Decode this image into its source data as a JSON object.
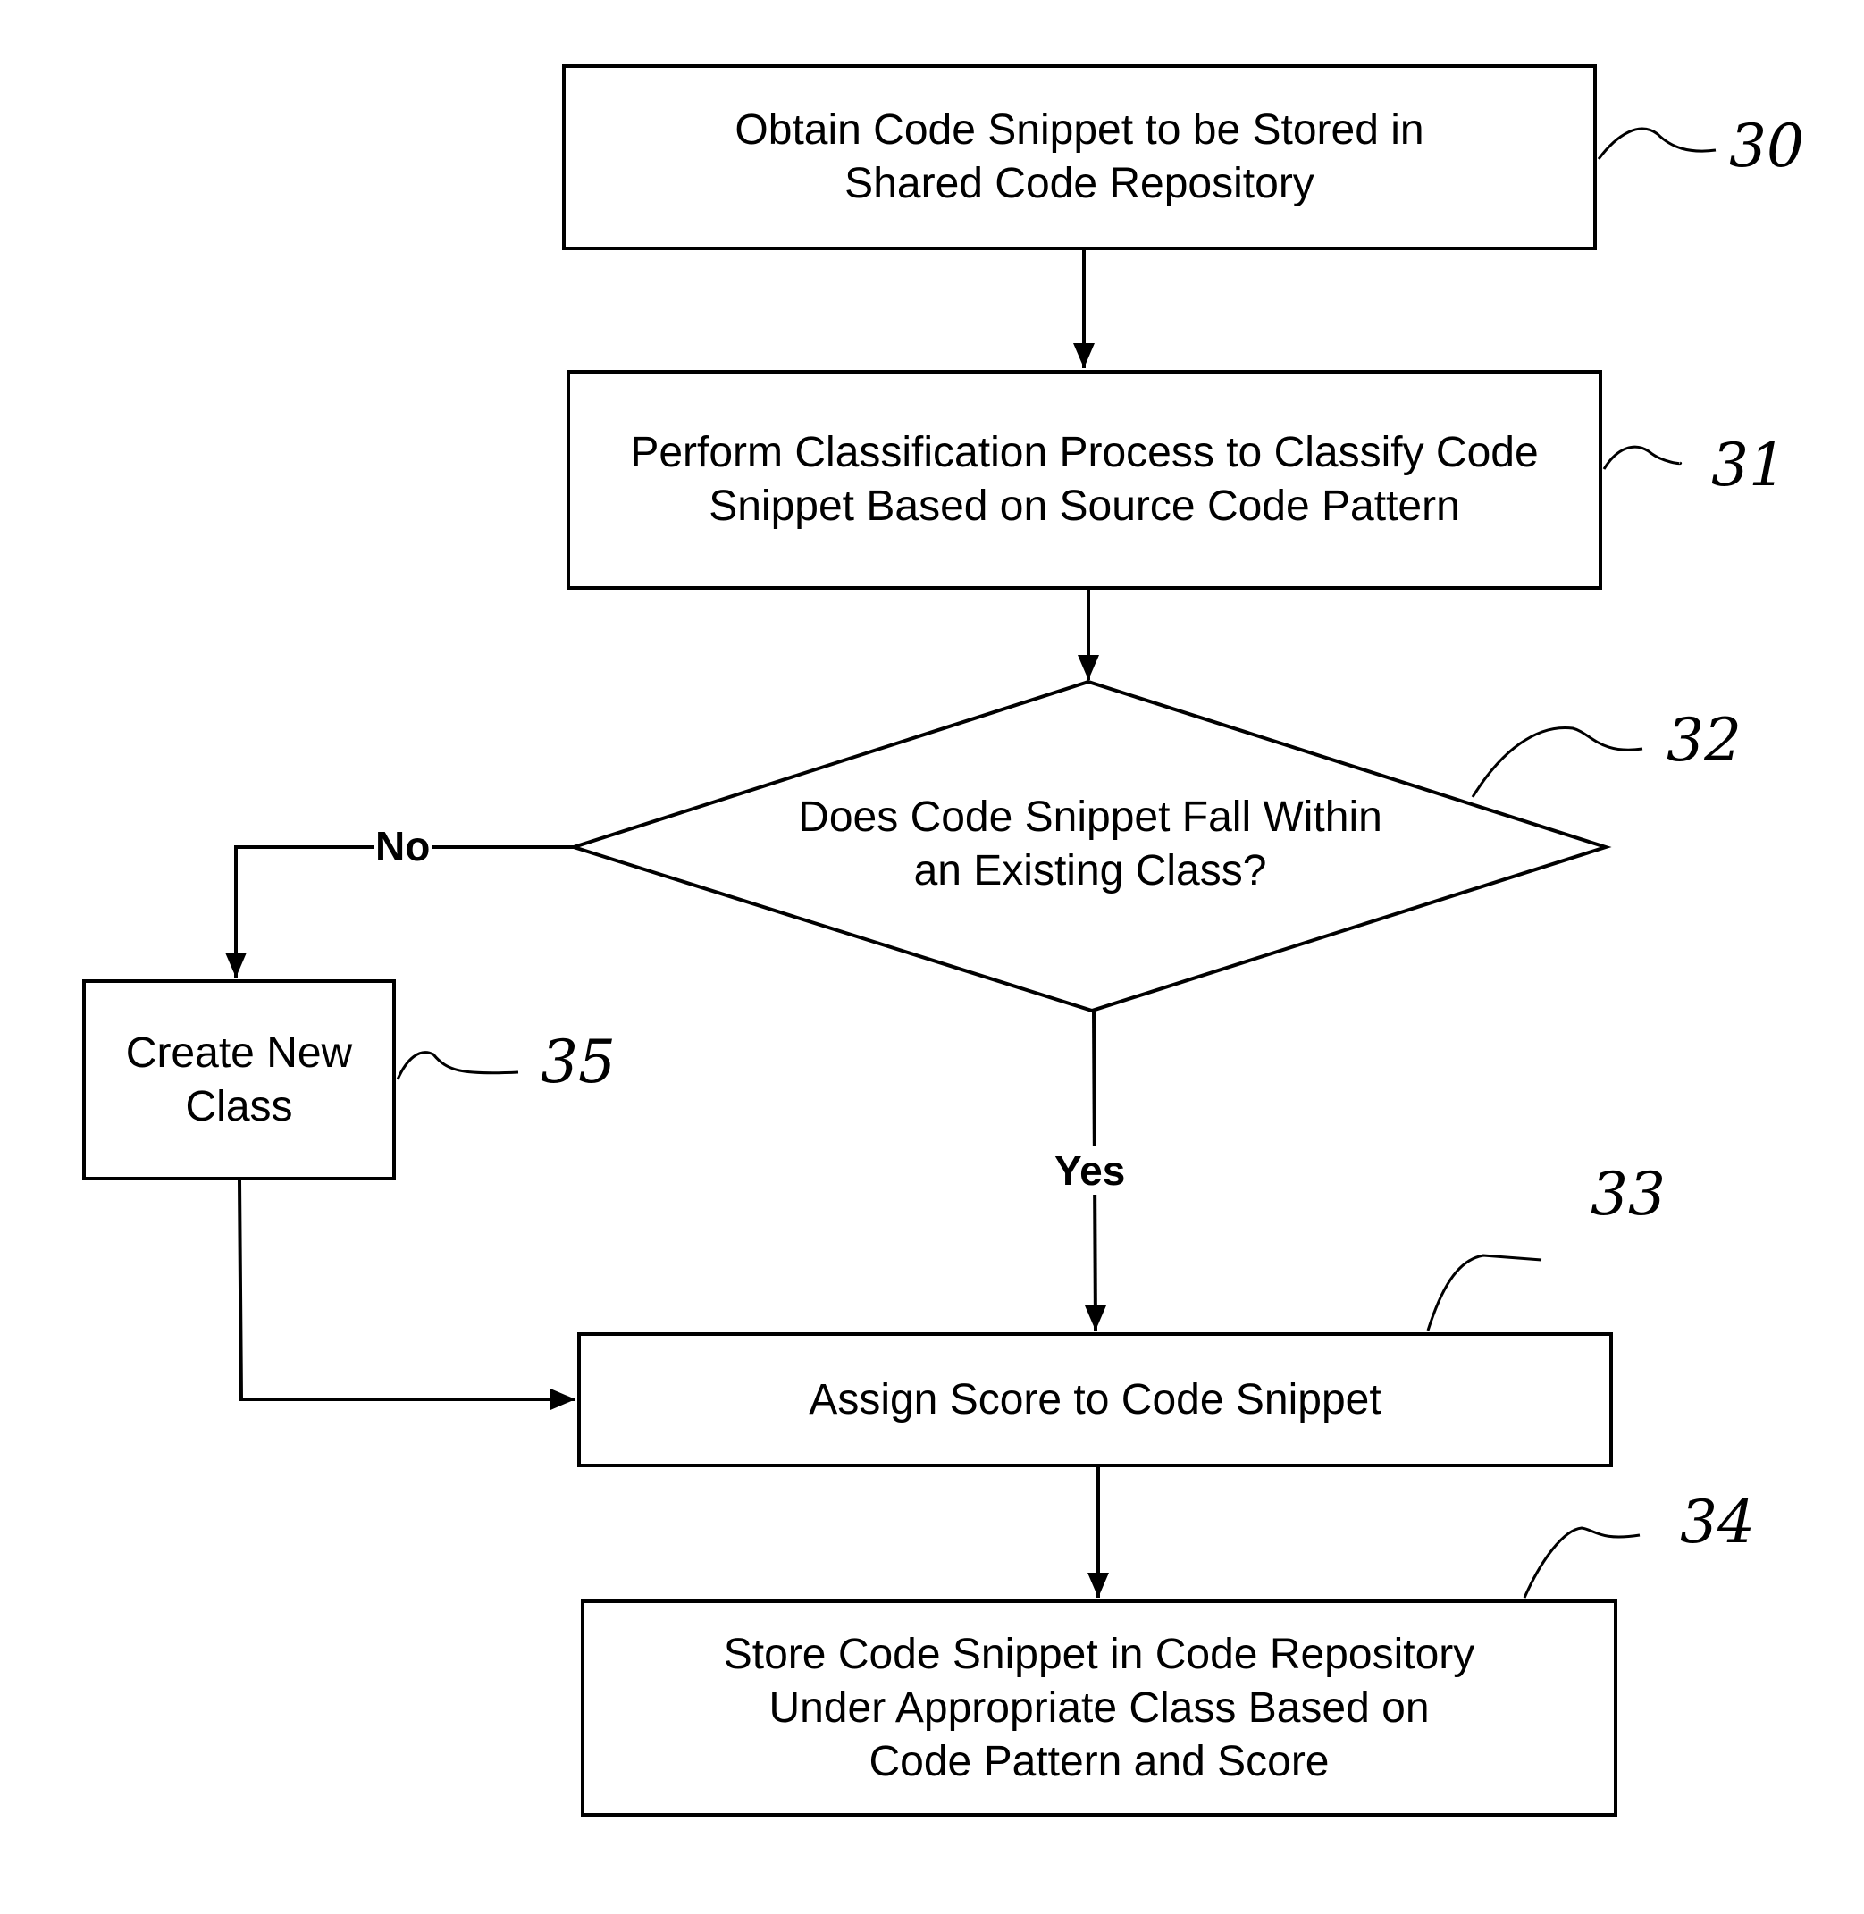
{
  "diagram": {
    "type": "flowchart",
    "nodes": [
      {
        "id": "30",
        "shape": "rect",
        "text": "Obtain Code Snippet to be Stored in\nShared Code Repository",
        "ref": "30"
      },
      {
        "id": "31",
        "shape": "rect",
        "text": "Perform Classification Process to Classify Code\nSnippet Based on Source Code Pattern",
        "ref": "31"
      },
      {
        "id": "32",
        "shape": "diamond",
        "text": "Does Code Snippet Fall Within\nan Existing Class?",
        "ref": "32"
      },
      {
        "id": "35",
        "shape": "rect",
        "text": "Create New\nClass",
        "ref": "35"
      },
      {
        "id": "33",
        "shape": "rect",
        "text": "Assign Score to Code Snippet",
        "ref": "33"
      },
      {
        "id": "34",
        "shape": "rect",
        "text": "Store Code Snippet in Code Repository\nUnder Appropriate Class Based on\nCode Pattern and Score",
        "ref": "34"
      }
    ],
    "edges": [
      {
        "from": "30",
        "to": "31",
        "label": ""
      },
      {
        "from": "31",
        "to": "32",
        "label": ""
      },
      {
        "from": "32",
        "to": "35",
        "label": "No"
      },
      {
        "from": "32",
        "to": "33",
        "label": "Yes"
      },
      {
        "from": "35",
        "to": "33",
        "label": ""
      },
      {
        "from": "33",
        "to": "34",
        "label": ""
      }
    ],
    "labels": {
      "no": "No",
      "yes": "Yes"
    }
  }
}
